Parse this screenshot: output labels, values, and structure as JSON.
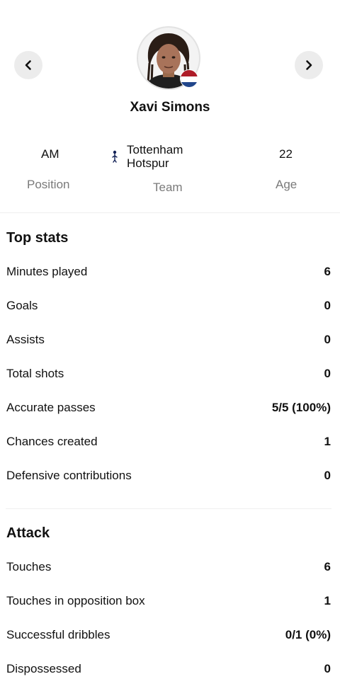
{
  "player": {
    "name": "Xavi Simons",
    "flag_colors": [
      "#AE1C28",
      "#FFFFFF",
      "#21468B"
    ]
  },
  "info": {
    "position_value": "AM",
    "position_label": "Position",
    "team_value_line1": "Tottenham",
    "team_value_line2": "Hotspur",
    "team_label": "Team",
    "age_value": "22",
    "age_label": "Age"
  },
  "top_stats": {
    "title": "Top stats",
    "rows": [
      {
        "label": "Minutes played",
        "value": "6"
      },
      {
        "label": "Goals",
        "value": "0"
      },
      {
        "label": "Assists",
        "value": "0"
      },
      {
        "label": "Total shots",
        "value": "0"
      },
      {
        "label": "Accurate passes",
        "value": "5/5 (100%)"
      },
      {
        "label": "Chances created",
        "value": "1"
      },
      {
        "label": "Defensive contributions",
        "value": "0"
      }
    ]
  },
  "attack": {
    "title": "Attack",
    "rows": [
      {
        "label": "Touches",
        "value": "6"
      },
      {
        "label": "Touches in opposition box",
        "value": "1"
      },
      {
        "label": "Successful dribbles",
        "value": "0/1 (0%)"
      },
      {
        "label": "Dispossessed",
        "value": "0"
      }
    ]
  },
  "icons": {
    "prev": "chevron-left-icon",
    "next": "chevron-right-icon",
    "team": "tottenham-badge-icon",
    "flag": "netherlands-flag-icon"
  }
}
